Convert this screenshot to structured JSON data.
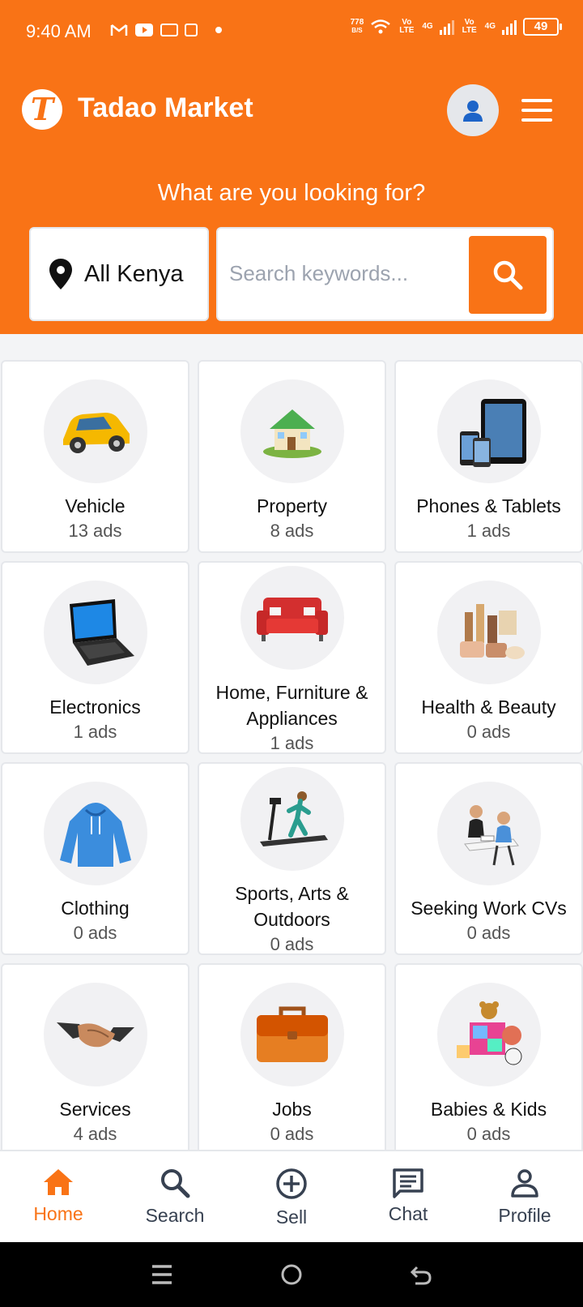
{
  "status": {
    "time": "9:40 AM",
    "net_speed_value": "778",
    "net_speed_unit": "B/S",
    "sim1_label": "Vo LTE",
    "sim1_type": "4G",
    "sim2_label": "Vo LTE",
    "sim2_type": "4G",
    "battery": "49"
  },
  "header": {
    "logo_letter": "T",
    "brand": "Tadao Market"
  },
  "hero": {
    "tagline": "What are you looking for?",
    "location": "All Kenya",
    "search_placeholder": "Search keywords..."
  },
  "categories": [
    {
      "name": "Vehicle",
      "count": "13 ads",
      "icon": "car-icon"
    },
    {
      "name": "Property",
      "count": "8 ads",
      "icon": "house-icon"
    },
    {
      "name": "Phones & Tablets",
      "count": "1 ads",
      "icon": "phone-tablet-icon"
    },
    {
      "name": "Electronics",
      "count": "1 ads",
      "icon": "laptop-icon"
    },
    {
      "name": "Home, Furniture & Appliances",
      "count": "1 ads",
      "icon": "sofa-icon"
    },
    {
      "name": "Health & Beauty",
      "count": "0 ads",
      "icon": "cosmetics-icon"
    },
    {
      "name": "Clothing",
      "count": "0 ads",
      "icon": "hoodie-icon"
    },
    {
      "name": "Sports, Arts & Outdoors",
      "count": "0 ads",
      "icon": "treadmill-icon"
    },
    {
      "name": "Seeking Work CVs",
      "count": "0 ads",
      "icon": "interview-icon"
    },
    {
      "name": "Services",
      "count": "4 ads",
      "icon": "handshake-icon"
    },
    {
      "name": "Jobs",
      "count": "0 ads",
      "icon": "briefcase-icon"
    },
    {
      "name": "Babies & Kids",
      "count": "0 ads",
      "icon": "toys-icon"
    }
  ],
  "bottom_nav": [
    {
      "label": "Home",
      "icon": "home-icon",
      "active": true
    },
    {
      "label": "Search",
      "icon": "search-icon",
      "active": false
    },
    {
      "label": "Sell",
      "icon": "plus-circle-icon",
      "active": false
    },
    {
      "label": "Chat",
      "icon": "chat-icon",
      "active": false
    },
    {
      "label": "Profile",
      "icon": "profile-icon",
      "active": false
    }
  ],
  "colors": {
    "accent": "#f97316",
    "background": "#f3f4f6",
    "card": "#ffffff",
    "nav_text": "#374151"
  }
}
